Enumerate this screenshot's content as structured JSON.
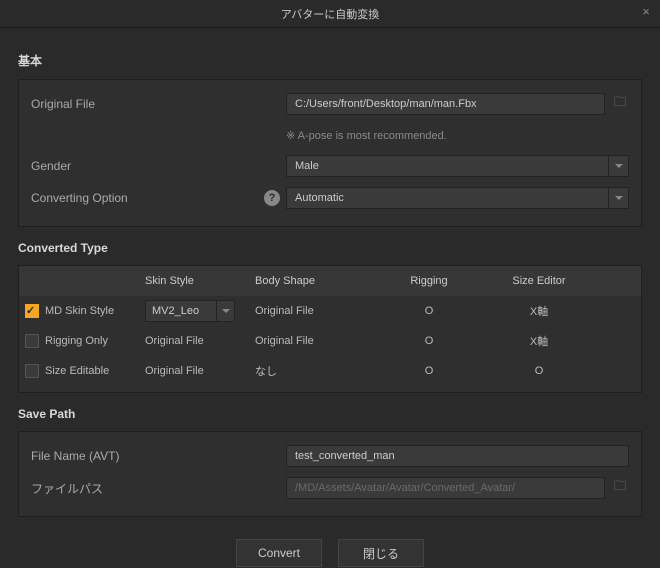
{
  "title": "アバターに自動変換",
  "sections": {
    "basic": "基本",
    "converted_type": "Converted Type",
    "save_path": "Save Path"
  },
  "basic": {
    "original_file_label": "Original File",
    "original_file_value": "C:/Users/front/Desktop/man/man.Fbx",
    "apose_note": "※ A-pose is most recommended.",
    "gender_label": "Gender",
    "gender_value": "Male",
    "converting_option_label": "Converting Option",
    "converting_option_value": "Automatic"
  },
  "converted_type": {
    "headers": {
      "skin_style": "Skin Style",
      "body_shape": "Body Shape",
      "rigging": "Rigging",
      "size_editor": "Size Editor"
    },
    "rows": [
      {
        "checked": true,
        "label": "MD Skin Style",
        "skin_style": "MV2_Leo",
        "skin_is_select": true,
        "body_shape": "Original File",
        "rigging": "O",
        "size_editor": "X軸"
      },
      {
        "checked": false,
        "label": "Rigging Only",
        "skin_style": "Original File",
        "skin_is_select": false,
        "body_shape": "Original File",
        "rigging": "O",
        "size_editor": "X軸"
      },
      {
        "checked": false,
        "label": "Size Editable",
        "skin_style": "Original File",
        "skin_is_select": false,
        "body_shape": "なし",
        "rigging": "O",
        "size_editor": "O"
      }
    ]
  },
  "save_path": {
    "file_name_label": "File Name (AVT)",
    "file_name_value": "test_converted_man",
    "file_path_label": "ファイルパス",
    "file_path_value": "/MD/Assets/Avatar/Avatar/Converted_Avatar/"
  },
  "footer": {
    "convert": "Convert",
    "close": "閉じる"
  },
  "icons": {
    "close_x": "×",
    "folder": "🗀",
    "help": "?"
  }
}
